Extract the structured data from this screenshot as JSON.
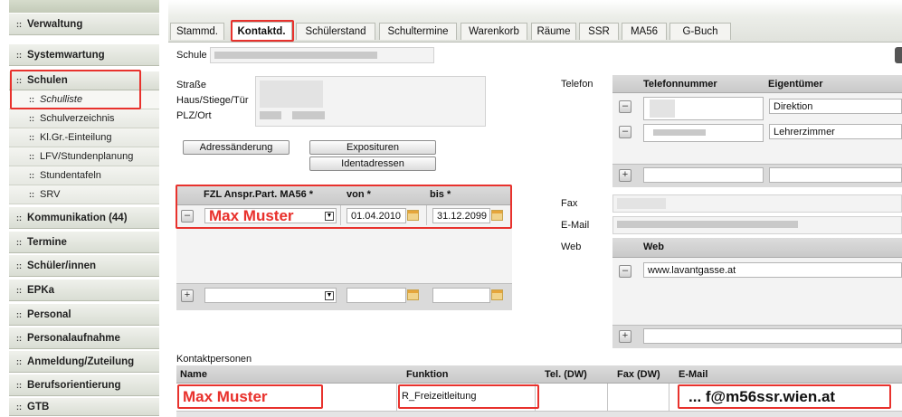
{
  "sidebar": {
    "items": [
      {
        "label": "Verwaltung"
      },
      {
        "label": "Systemwartung"
      },
      {
        "label": "Schulen"
      },
      {
        "label": "Schulliste"
      },
      {
        "label": "Schulverzeichnis"
      },
      {
        "label": "Kl.Gr.-Einteilung"
      },
      {
        "label": "LFV/Stundenplanung"
      },
      {
        "label": "Stundentafeln"
      },
      {
        "label": "SRV"
      },
      {
        "label": "Kommunikation (44)"
      },
      {
        "label": "Termine"
      },
      {
        "label": "Schüler/innen"
      },
      {
        "label": "EPKa"
      },
      {
        "label": "Personal"
      },
      {
        "label": "Personalaufnahme"
      },
      {
        "label": "Anmeldung/Zuteilung"
      },
      {
        "label": "Berufsorientierung"
      },
      {
        "label": "GTB"
      }
    ],
    "bullet": "::"
  },
  "tabs": [
    "Stammd.",
    "Kontaktd.",
    "Schülerstand",
    "Schultermine",
    "Warenkorb",
    "Räume",
    "SSR",
    "MA56",
    "G-Buch"
  ],
  "school": {
    "label": "Schule"
  },
  "address": {
    "street_label": "Straße",
    "house_label": "Haus/Stiege/Tür",
    "zip_label": "PLZ/Ort",
    "change_button": "Adressänderung",
    "expo_button": "Exposituren",
    "ident_button": "Identadressen"
  },
  "fzl": {
    "headers": [
      "FZL Anspr.Part. MA56 *",
      "von *",
      "bis *"
    ],
    "row": {
      "name": "Max Muster",
      "from": "01.04.2010",
      "to": "31.12.2099"
    },
    "minus": "–",
    "plus": "+"
  },
  "phone": {
    "label": "Telefon",
    "headers": [
      "Telefonnummer",
      "Eigentümer"
    ],
    "rows": [
      {
        "owner": "Direktion"
      },
      {
        "owner": "Lehrerzimmer"
      }
    ]
  },
  "fax_label": "Fax",
  "email_label": "E-Mail",
  "web": {
    "label": "Web",
    "header": "Web",
    "rows": [
      {
        "url": "www.lavantgasse.at"
      }
    ]
  },
  "contacts": {
    "title": "Kontaktpersonen",
    "headers": [
      "Name",
      "Funktion",
      "Tel. (DW)",
      "Fax (DW)",
      "E-Mail"
    ],
    "row": {
      "name": "Max Muster",
      "function": "R_Freizeitleitung",
      "email": "... f@m56ssr.wien.at"
    }
  },
  "colors": {
    "highlight": "#e8322d"
  }
}
